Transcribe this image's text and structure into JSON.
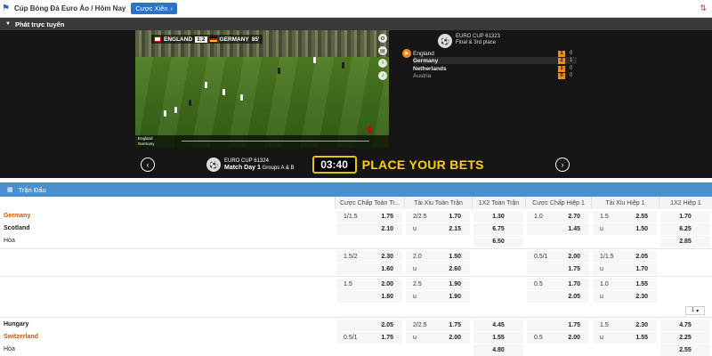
{
  "topbar": {
    "title": "Cúp Bóng Đá Euro Áo / Hôm Nay",
    "parlay_button": "Cược Xiên"
  },
  "live": {
    "label": "Phát trực tuyến"
  },
  "video": {
    "team1": "ENGLAND",
    "score": "1:2",
    "team2": "GERMANY",
    "minute": "85'",
    "legend1": "England",
    "legend2": "Germany"
  },
  "match_panel": {
    "event": "EURO CUP 61323",
    "stage": "Final & 3rd place",
    "rows": [
      {
        "name": "England",
        "box": "1",
        "num": "0"
      },
      {
        "name": "Germany",
        "box": "2",
        "num": "1"
      },
      {
        "name": "Netherlands",
        "box": "1",
        "num": "0"
      },
      {
        "name": "Austria",
        "box": "0",
        "num": "0"
      }
    ]
  },
  "banner": {
    "event": "EURO CUP 61324",
    "match": "Match Day 1",
    "groups": "Groups A & B",
    "timer": "03:40",
    "cta": "PLACE YOUR BETS"
  },
  "section": {
    "title": "Trận Đấu"
  },
  "columns": [
    "Cược Chấp Toàn Tr...",
    "Tài Xỉu Toàn Trận",
    "1X2 Toàn Trận",
    "Cược Chấp Hiệp 1",
    "Tài Xỉu Hiệp 1",
    "1X2 Hiệp 1"
  ],
  "match1": {
    "home": "Germany",
    "away": "Scotland",
    "draw": "Hòa",
    "r1": {
      "hc": "1/1.5",
      "hco": "1.75",
      "ou": "2/2.5",
      "ouo": "1.70",
      "x12": "1.30",
      "h1c": "1.0",
      "h1co": "2.70",
      "h1ou": "1.5",
      "h1ouo": "2.55",
      "h1x12": "1.70"
    },
    "r2": {
      "hco": "2.10",
      "ou": "u",
      "ouo": "2.15",
      "x12": "6.75",
      "h1co": "1.45",
      "h1ou": "u",
      "h1ouo": "1.50",
      "h1x12": "6.25"
    },
    "r3": {
      "x12": "6.50",
      "h1x12": "2.85"
    },
    "r4": {
      "hc": "1.5/2",
      "hco": "2.30",
      "ou": "2.0",
      "ouo": "1.50",
      "h1c": "0.5/1",
      "h1co": "2.00",
      "h1ou": "1/1.5",
      "h1ouo": "2.05"
    },
    "r5": {
      "hco": "1.60",
      "ou": "u",
      "ouo": "2.60",
      "h1co": "1.75",
      "h1ou": "u",
      "h1ouo": "1.70"
    },
    "r6": {
      "hc": "1.5",
      "hco": "2.00",
      "ou": "2.5",
      "ouo": "1.90",
      "h1c": "0.5",
      "h1co": "1.70",
      "h1ou": "1.0",
      "h1ouo": "1.55"
    },
    "r7": {
      "hco": "1.80",
      "ou": "u",
      "ouo": "1.90",
      "h1co": "2.05",
      "h1ou": "u",
      "h1ouo": "2.30"
    }
  },
  "pager": {
    "value": "1"
  },
  "match2": {
    "home": "Hungary",
    "away": "Switzerland",
    "draw": "Hòa",
    "r1": {
      "hco": "2.05",
      "ou": "2/2.5",
      "ouo": "1.75",
      "x12": "4.45",
      "h1co": "1.75",
      "h1ou": "1.5",
      "h1ouo": "2.30",
      "h1x12": "4.75"
    },
    "r2": {
      "hc": "0.5/1",
      "hco": "1.75",
      "ou": "u",
      "ouo": "2.00",
      "x12": "1.55",
      "h1c": "0.5",
      "h1co": "2.00",
      "h1ou": "u",
      "h1ouo": "1.55",
      "h1x12": "2.25"
    },
    "r3": {
      "x12": "4.80",
      "h1x12": "2.55"
    }
  },
  "colors": {
    "accent": "#4a8fd0",
    "favorite": "#d35400",
    "cta": "#ffd200"
  }
}
